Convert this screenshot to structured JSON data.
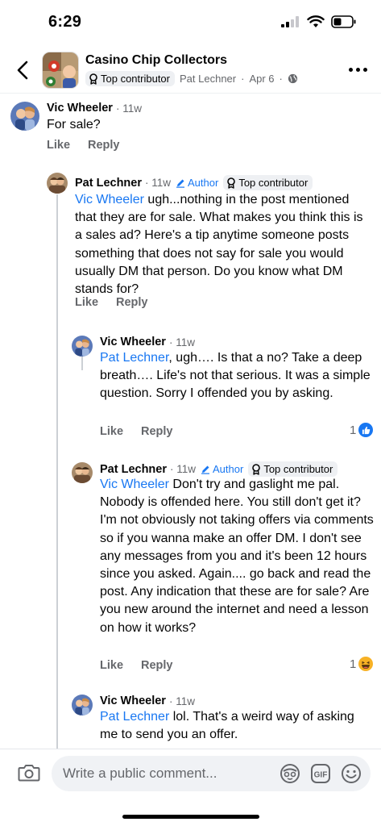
{
  "status_bar": {
    "time": "6:29"
  },
  "header": {
    "group_name": "Casino Chip Collectors",
    "badge": "Top contributor",
    "poster": "Pat Lechner",
    "date": "Apr 6",
    "separator": "·"
  },
  "comments": [
    {
      "name": "Vic Wheeler",
      "time": "· 11w",
      "text": "For sale?",
      "like": "Like",
      "reply": "Reply"
    },
    {
      "name": "Pat Lechner",
      "time": "· 11w",
      "author_badge": "Author",
      "contributor_badge": "Top contributor",
      "mention": "Vic Wheeler",
      "text": " ugh...nothing in the post mentioned that they are for sale. What makes you think this is a sales ad? Here's a tip anytime someone posts something that does not say for sale you would usually DM that person. Do you know what DM stands for?",
      "like": "Like",
      "reply": "Reply"
    },
    {
      "name": "Vic Wheeler",
      "time": "· 11w",
      "mention": "Pat Lechner",
      "text": ", ugh…. Is that a no? Take a deep breath….  Life's not that serious. It was a simple question. Sorry I offended you by asking.",
      "like": "Like",
      "reply": "Reply",
      "reaction_count": "1",
      "reaction": "like-reaction-icon"
    },
    {
      "name": "Pat Lechner",
      "time": "· 11w",
      "author_badge": "Author",
      "contributor_badge": "Top contributor",
      "mention": "Vic Wheeler",
      "text": " Don't try and gaslight me pal. Nobody is offended here. You still don't get it?  I'm not obviously not taking offers via comments so if you wanna make an offer DM. I don't see any messages from you and it's been 12 hours since you asked. Again.... go back and read the post. Any indication that these are for sale? Are you new around the internet and need a lesson on how it works?",
      "like": "Like",
      "reply": "Reply",
      "reaction_count": "1",
      "reaction": "haha-reaction-icon"
    },
    {
      "name": "Vic Wheeler",
      "time": "· 11w",
      "mention": "Pat Lechner",
      "text": " lol.  That's a weird way of asking me to send you an offer."
    }
  ],
  "composer": {
    "placeholder": "Write a public comment...",
    "gif_label": "GIF"
  },
  "colors": {
    "accent": "#1877f2",
    "muted": "#65676b",
    "badge_bg": "#eef0f3",
    "haha": "#f7b125"
  }
}
